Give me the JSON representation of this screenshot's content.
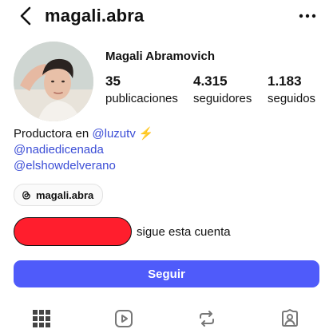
{
  "header": {
    "back_icon": "chevron-left-icon",
    "username": "magali.abra",
    "more_icon": "more-horizontal-icon"
  },
  "profile": {
    "display_name": "Magali Abramovich",
    "stats": [
      {
        "value": "35",
        "label": "publicaciones"
      },
      {
        "value": "4.315",
        "label": "seguidores"
      },
      {
        "value": "1.183",
        "label": "seguidos"
      }
    ]
  },
  "bio": {
    "line1_prefix": "Productora en ",
    "line1_mention": "@luzutv",
    "line1_emoji": "⚡",
    "line2_mention": "@nadiedicenada",
    "line3_mention": "@elshowdelverano"
  },
  "threads_chip": {
    "icon": "threads-icon",
    "label": "magali.abra"
  },
  "followed_by": {
    "text": "sigue esta cuenta",
    "redaction_color": "#ff1e2d"
  },
  "follow_button": {
    "label": "Seguir",
    "color": "#4f5bfa"
  },
  "tabs": [
    {
      "icon": "grid-icon"
    },
    {
      "icon": "reels-play-icon"
    },
    {
      "icon": "reposts-icon"
    },
    {
      "icon": "tagged-person-icon"
    }
  ]
}
